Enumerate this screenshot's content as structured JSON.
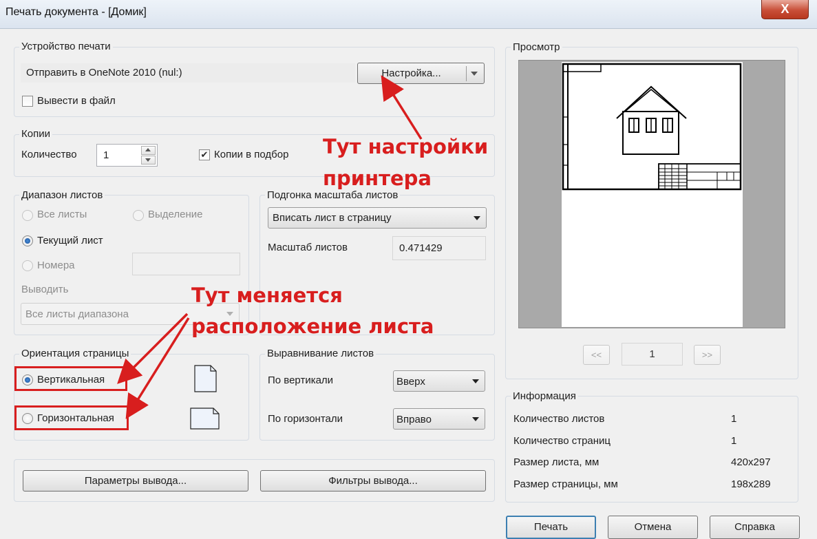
{
  "window": {
    "title": "Печать документа - [Домик]",
    "close_glyph": "X"
  },
  "device": {
    "group_label": "Устройство печати",
    "printer_value": "Отправить в OneNote 2010 (nul:)",
    "settings_button": "Настройка...",
    "print_to_file_label": "Вывести в файл",
    "print_to_file_checked": false
  },
  "copies": {
    "group_label": "Копии",
    "quantity_label": "Количество",
    "quantity_value": "1",
    "collate_label": "Копии в подбор",
    "collate_checked": true
  },
  "range": {
    "group_label": "Диапазон листов",
    "all_sheets": "Все листы",
    "selection": "Выделение",
    "current_sheet": "Текущий лист",
    "numbers": "Номера",
    "numbers_value": "",
    "output_label": "Выводить",
    "output_value": "Все листы диапазона",
    "selected": "current_sheet"
  },
  "scaling": {
    "group_label": "Подгонка масштаба листов",
    "fit_value": "Вписать лист в страницу",
    "scale_label": "Масштаб листов",
    "scale_value": "0.471429"
  },
  "orientation": {
    "group_label": "Ориентация страницы",
    "portrait": "Вертикальная",
    "landscape": "Горизонтальная",
    "selected": "portrait"
  },
  "alignment": {
    "group_label": "Выравнивание листов",
    "vertical_label": "По вертикали",
    "vertical_value": "Вверх",
    "horizontal_label": "По горизонтали",
    "horizontal_value": "Вправо"
  },
  "buttons": {
    "output_params": "Параметры вывода...",
    "output_filters": "Фильтры вывода...",
    "print": "Печать",
    "cancel": "Отмена",
    "help": "Справка"
  },
  "preview": {
    "group_label": "Просмотр",
    "prev": "<<",
    "next": ">>",
    "page": "1"
  },
  "info": {
    "group_label": "Информация",
    "rows": [
      {
        "label": "Количество листов",
        "value": "1"
      },
      {
        "label": "Количество страниц",
        "value": "1"
      },
      {
        "label": "Размер листа, мм",
        "value": "420x297"
      },
      {
        "label": "Размер страницы, мм",
        "value": "198x289"
      }
    ]
  },
  "annotations": {
    "printer_settings_line1": "Тут настройки",
    "printer_settings_line2": "принтера",
    "orientation_line1": "Тут меняется",
    "orientation_line2": "расположение листа",
    "color": "#d81e1e"
  }
}
